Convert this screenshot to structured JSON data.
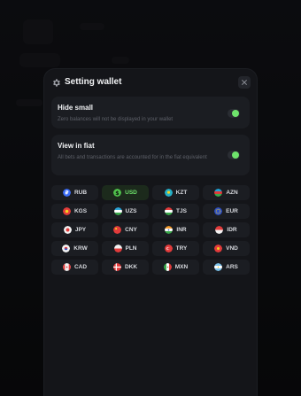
{
  "modal": {
    "title": "Setting wallet"
  },
  "settings": [
    {
      "title": "Hide small",
      "description": "Zero balances will not be displayed in your wallet",
      "enabled": true
    },
    {
      "title": "View in fiat",
      "description": "All bets and transactions are accounted for in the fiat equivalent",
      "enabled": true
    }
  ],
  "currencies": [
    {
      "code": "RUB",
      "flag": "rub-icon",
      "selected": false
    },
    {
      "code": "USD",
      "flag": "dollar-icon",
      "selected": true
    },
    {
      "code": "KZT",
      "flag": "kazakhstan-flag-icon",
      "selected": false
    },
    {
      "code": "AZN",
      "flag": "azerbaijan-flag-icon",
      "selected": false
    },
    {
      "code": "KGS",
      "flag": "kyrgyzstan-flag-icon",
      "selected": false
    },
    {
      "code": "UZS",
      "flag": "uzbekistan-flag-icon",
      "selected": false
    },
    {
      "code": "TJS",
      "flag": "tajikistan-flag-icon",
      "selected": false
    },
    {
      "code": "EUR",
      "flag": "eu-flag-icon",
      "selected": false
    },
    {
      "code": "JPY",
      "flag": "japan-flag-icon",
      "selected": false
    },
    {
      "code": "CNY",
      "flag": "china-flag-icon",
      "selected": false
    },
    {
      "code": "INR",
      "flag": "india-flag-icon",
      "selected": false
    },
    {
      "code": "IDR",
      "flag": "indonesia-flag-icon",
      "selected": false
    },
    {
      "code": "KRW",
      "flag": "korea-flag-icon",
      "selected": false
    },
    {
      "code": "PLN",
      "flag": "poland-flag-icon",
      "selected": false
    },
    {
      "code": "TRY",
      "flag": "turkey-flag-icon",
      "selected": false
    },
    {
      "code": "VND",
      "flag": "vietnam-flag-icon",
      "selected": false
    },
    {
      "code": "CAD",
      "flag": "canada-flag-icon",
      "selected": false
    },
    {
      "code": "DKK",
      "flag": "denmark-flag-icon",
      "selected": false
    },
    {
      "code": "MXN",
      "flag": "mexico-flag-icon",
      "selected": false
    },
    {
      "code": "ARS",
      "flag": "argentina-flag-icon",
      "selected": false
    }
  ],
  "colors": {
    "accent": "#6ee36b",
    "modal_bg": "#141519",
    "card_bg": "#1b1d22",
    "selected_bg": "#1c2a1c"
  }
}
